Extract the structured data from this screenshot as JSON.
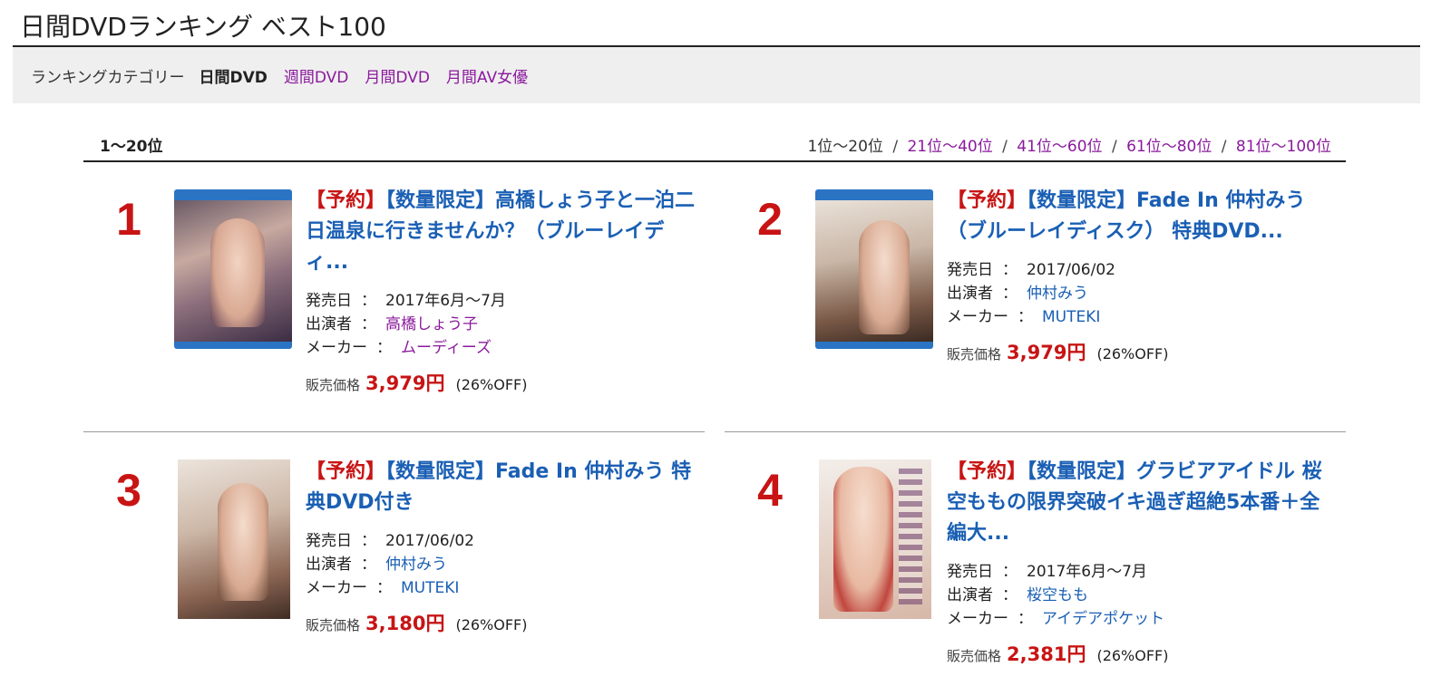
{
  "page": {
    "title": "日間DVDランキング ベスト100"
  },
  "category": {
    "label": "ランキングカテゴリー",
    "current": "日間DVD",
    "links": [
      "週間DVD",
      "月間DVD",
      "月間AV女優"
    ]
  },
  "range": {
    "current": "1〜20位",
    "pager_current": "1位〜20位",
    "pager_links": [
      "21位〜40位",
      "41位〜60位",
      "61位〜80位",
      "81位〜100位"
    ],
    "separator": "/"
  },
  "meta_labels": {
    "release": "発売日",
    "cast": "出演者",
    "maker": "メーカー",
    "colon": "：",
    "price": "販売価格"
  },
  "items": [
    {
      "rank": "1",
      "tag_reserve": "【予約】",
      "title": "【数量限定】高橋しょう子と一泊二日温泉に行きませんか？（ブルーレイディ...",
      "release": "2017年6月〜7月",
      "cast": "高橋しょう子",
      "maker": "ムーディーズ",
      "price": "3,979円",
      "discount": "(26%OFF)",
      "cover_style": "bluray"
    },
    {
      "rank": "2",
      "tag_reserve": "【予約】",
      "title": "【数量限定】Fade In 仲村みう（ブルーレイディスク） 特典DVD...",
      "release": "2017/06/02",
      "cast": "仲村みう",
      "maker": "MUTEKI",
      "price": "3,979円",
      "discount": "(26%OFF)",
      "cover_style": "bluray"
    },
    {
      "rank": "3",
      "tag_reserve": "【予約】",
      "title": "【数量限定】Fade In 仲村みう 特典DVD付き",
      "release": "2017/06/02",
      "cast": "仲村みう",
      "maker": "MUTEKI",
      "price": "3,180円",
      "discount": "(26%OFF)",
      "cover_style": "dvd"
    },
    {
      "rank": "4",
      "tag_reserve": "【予約】",
      "title": "【数量限定】グラビアアイドル 桜空ももの限界突破イキ過ぎ超絶5本番＋全編大...",
      "release": "2017年6月〜7月",
      "cast": "桜空もも",
      "maker": "アイデアポケット",
      "price": "2,381円",
      "discount": "(26%OFF)",
      "cover_style": "dvd"
    }
  ],
  "colors": {
    "accent_red": "#c81414",
    "link_blue": "#1a5fb4",
    "link_purple": "#8a1a9c",
    "bluray_blue": "#2b74c4"
  }
}
